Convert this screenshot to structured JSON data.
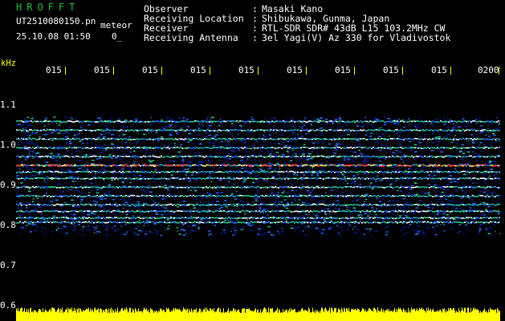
{
  "header": {
    "brand": "HROFFT",
    "filename": "UT2510080150.pn",
    "watermark": "meteor",
    "datetime": "25.10.08 01:50",
    "zoom": "0_"
  },
  "meta": [
    {
      "key": "Observer",
      "value": "Masaki Kano"
    },
    {
      "key": "Receiving Location",
      "value": "Shibukawa, Gunma, Japan"
    },
    {
      "key": "Receiver",
      "value": "RTL-SDR SDR# 43dB L15 103.2MHz CW"
    },
    {
      "key": "Receiving Antenna",
      "value": "3el Yagi(V) Az 330 for Vladivostok"
    }
  ],
  "meta_separator": ":",
  "axis": {
    "y_unit": "kHz",
    "y_ticks": [
      "1.1",
      "1.0",
      "0.9",
      "0.8",
      "0.7",
      "0.6"
    ],
    "x_ticks": [
      "015",
      "015",
      "015",
      "015",
      "015",
      "015",
      "015",
      "015",
      "015",
      "0200"
    ]
  },
  "colors": {
    "background": "#000000",
    "brand": "#25c437",
    "text": "#ffffff",
    "axis_unit": "#ffff00",
    "tick": "#ffff00",
    "noise_low": "#0a1aa0",
    "noise_mid": "#2a6cff",
    "noise_high": "#23d08a",
    "hot": "#ff3030",
    "power_bar": "#ffff00"
  },
  "spectrogram": {
    "y_min_khz": 0.6,
    "y_max_khz": 1.12,
    "band_top_khz": 1.03,
    "band_bottom_khz": 0.76,
    "carrier_lines_khz": [
      1.02,
      1.0,
      0.98,
      0.96,
      0.94,
      0.92,
      0.905,
      0.89,
      0.87,
      0.85,
      0.83,
      0.815,
      0.8,
      0.79
    ],
    "hot_line_khz": 0.92
  }
}
